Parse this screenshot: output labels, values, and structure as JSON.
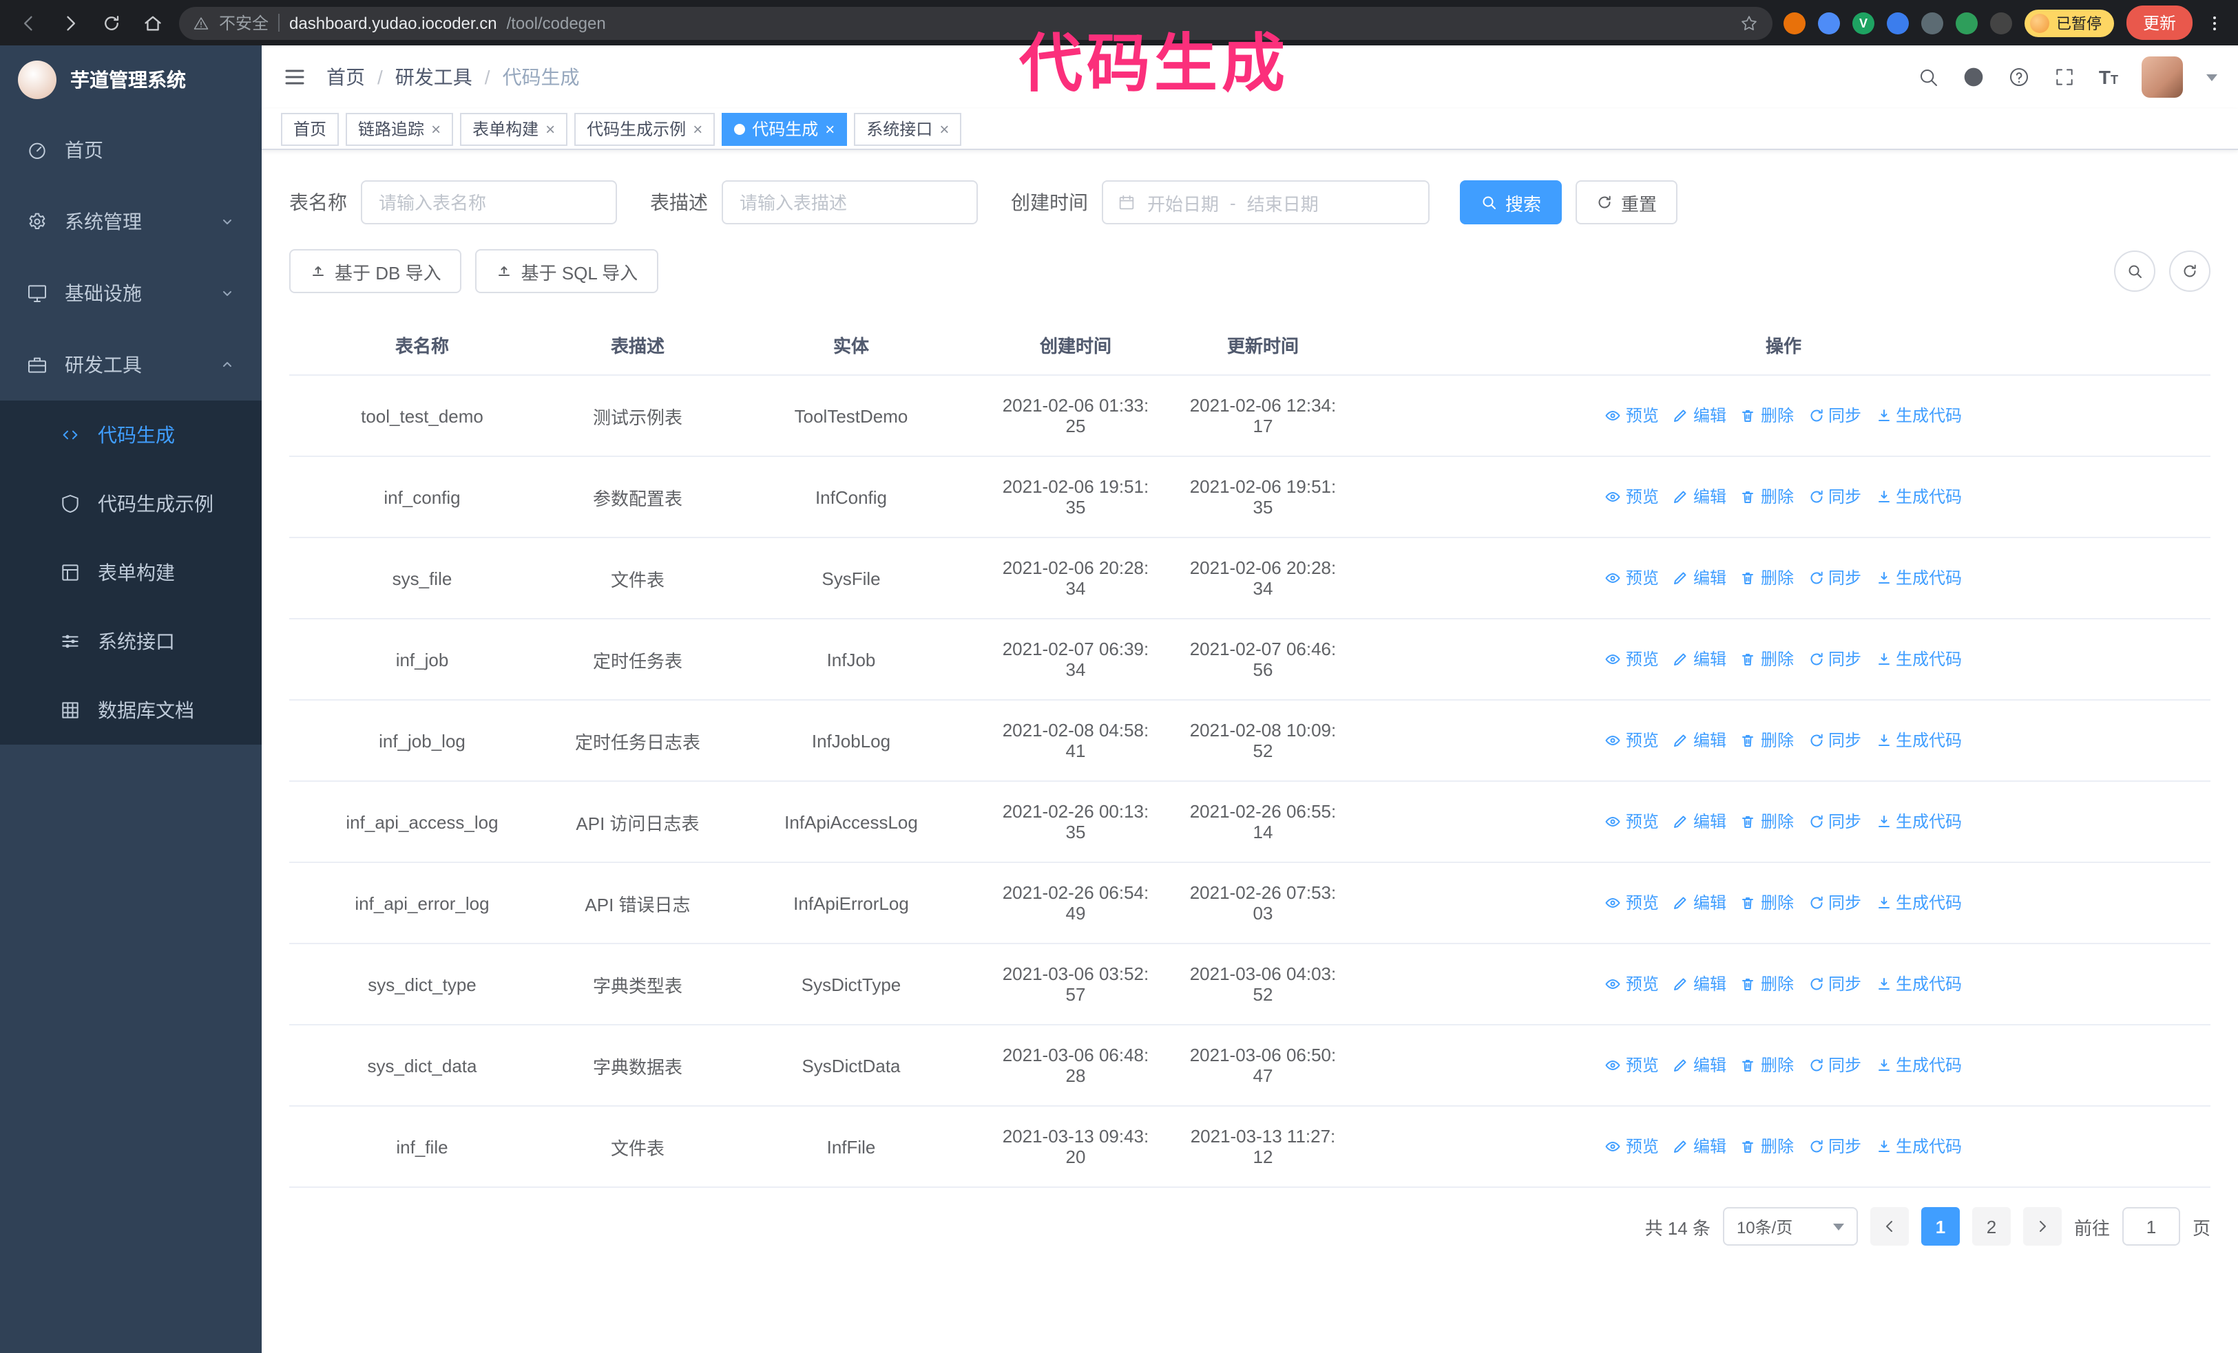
{
  "colors": {
    "accent": "#409eff",
    "sidebar_bg": "#304156",
    "submenu_bg": "#1f2d3d",
    "annotation": "#fb2f7b",
    "update_button_bg": "#e9584c",
    "paused_badge_bg": "#fdd663"
  },
  "annotation": {
    "text": "代码生成"
  },
  "browser": {
    "security_label": "不安全",
    "url_domain": "dashboard.yudao.iocoder.cn",
    "url_path": "/tool/codegen",
    "paused_badge": "已暂停",
    "update_button": "更新",
    "green_extension_letter": "V"
  },
  "sidebar": {
    "logo_title": "芋道管理系统",
    "items": [
      {
        "label": "首页"
      },
      {
        "label": "系统管理"
      },
      {
        "label": "基础设施"
      },
      {
        "label": "研发工具",
        "children": [
          {
            "label": "代码生成",
            "active": true
          },
          {
            "label": "代码生成示例"
          },
          {
            "label": "表单构建"
          },
          {
            "label": "系统接口"
          },
          {
            "label": "数据库文档"
          }
        ]
      }
    ]
  },
  "header": {
    "breadcrumb": [
      "首页",
      "研发工具",
      "代码生成"
    ]
  },
  "tags": [
    {
      "label": "首页"
    },
    {
      "label": "链路追踪"
    },
    {
      "label": "表单构建"
    },
    {
      "label": "代码生成示例"
    },
    {
      "label": "代码生成"
    },
    {
      "label": "系统接口"
    }
  ],
  "filters": {
    "table_name_label": "表名称",
    "table_name_placeholder": "请输入表名称",
    "table_desc_label": "表描述",
    "table_desc_placeholder": "请输入表描述",
    "create_time_label": "创建时间",
    "date_start_placeholder": "开始日期",
    "date_separator": "-",
    "date_end_placeholder": "结束日期",
    "search_button": "搜索",
    "reset_button": "重置"
  },
  "toolbar": {
    "import_db_button": "基于 DB 导入",
    "import_sql_button": "基于 SQL 导入"
  },
  "table": {
    "columns": [
      "表名称",
      "表描述",
      "实体",
      "创建时间",
      "更新时间",
      "操作"
    ],
    "ops": [
      "预览",
      "编辑",
      "删除",
      "同步",
      "生成代码"
    ],
    "rows": [
      {
        "name": "tool_test_demo",
        "desc": "测试示例表",
        "entity": "ToolTestDemo",
        "created": "2021-02-06 01:33:25",
        "updated": "2021-02-06 12:34:17"
      },
      {
        "name": "inf_config",
        "desc": "参数配置表",
        "entity": "InfConfig",
        "created": "2021-02-06 19:51:35",
        "updated": "2021-02-06 19:51:35"
      },
      {
        "name": "sys_file",
        "desc": "文件表",
        "entity": "SysFile",
        "created": "2021-02-06 20:28:34",
        "updated": "2021-02-06 20:28:34"
      },
      {
        "name": "inf_job",
        "desc": "定时任务表",
        "entity": "InfJob",
        "created": "2021-02-07 06:39:34",
        "updated": "2021-02-07 06:46:56"
      },
      {
        "name": "inf_job_log",
        "desc": "定时任务日志表",
        "entity": "InfJobLog",
        "created": "2021-02-08 04:58:41",
        "updated": "2021-02-08 10:09:52"
      },
      {
        "name": "inf_api_access_log",
        "desc": "API 访问日志表",
        "entity": "InfApiAccessLog",
        "created": "2021-02-26 00:13:35",
        "updated": "2021-02-26 06:55:14"
      },
      {
        "name": "inf_api_error_log",
        "desc": "API 错误日志",
        "entity": "InfApiErrorLog",
        "created": "2021-02-26 06:54:49",
        "updated": "2021-02-26 07:53:03"
      },
      {
        "name": "sys_dict_type",
        "desc": "字典类型表",
        "entity": "SysDictType",
        "created": "2021-03-06 03:52:57",
        "updated": "2021-03-06 04:03:52"
      },
      {
        "name": "sys_dict_data",
        "desc": "字典数据表",
        "entity": "SysDictData",
        "created": "2021-03-06 06:48:28",
        "updated": "2021-03-06 06:50:47"
      },
      {
        "name": "inf_file",
        "desc": "文件表",
        "entity": "InfFile",
        "created": "2021-03-13 09:43:20",
        "updated": "2021-03-13 11:27:12"
      }
    ]
  },
  "pagination": {
    "total": "共 14 条",
    "page_size": "10条/页",
    "pages": [
      "1",
      "2"
    ],
    "active_page": "1",
    "goto_label": "前往",
    "goto_value": "1",
    "goto_suffix": "页"
  }
}
